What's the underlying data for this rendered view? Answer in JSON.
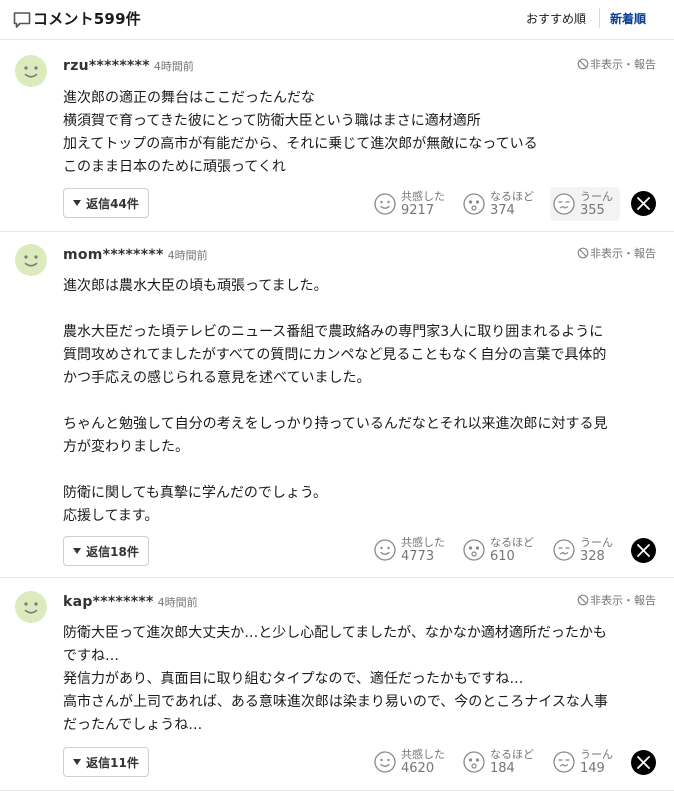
{
  "header": {
    "title": "コメント599件",
    "sort_recommended": "おすすめ順",
    "sort_newest": "新着順"
  },
  "labels": {
    "hide": "非表示",
    "dot": "・",
    "report": "報告",
    "empathy": "共感した",
    "naruhodo": "なるほど",
    "uun": "うーん"
  },
  "comments": [
    {
      "user": "rzu********",
      "time": "4時間前",
      "lines": [
        "進次郎の適正の舞台はここだったんだな",
        "横須賀で育ってきた彼にとって防衛大臣という職はまさに適材適所",
        "加えてトップの高市が有能だから、それに乗じて進次郎が無敵になっている",
        "このまま日本のために頑張ってくれ"
      ],
      "reply_label": "返信44件",
      "empathy": "9217",
      "naruhodo": "374",
      "uun": "355"
    },
    {
      "user": "mom********",
      "time": "4時間前",
      "lines": [
        "進次郎は農水大臣の頃も頑張ってました。",
        "",
        "農水大臣だった頃テレビのニュース番組で農政絡みの専門家3人に取り囲まれるように",
        "質問攻めされてましたがすべての質問にカンペなど見ることもなく自分の言葉で具体的",
        "かつ手応えの感じられる意見を述べていました。",
        "",
        "ちゃんと勉強して自分の考えをしっかり持っているんだなとそれ以来進次郎に対する見",
        "方が変わりました。",
        "",
        "防衛に関しても真摯に学んだのでしょう。",
        "応援してます。"
      ],
      "reply_label": "返信18件",
      "empathy": "4773",
      "naruhodo": "610",
      "uun": "328"
    },
    {
      "user": "kap********",
      "time": "4時間前",
      "lines": [
        "防衛大臣って進次郎大丈夫か…と少し心配してましたが、なかなか適材適所だったかも",
        "ですね…",
        "発信力があり、真面目に取り組むタイプなので、適任だったかもですね…",
        "高市さんが上司であれば、ある意味進次郎は染まり易いので、今のところナイスな人事",
        "だったんでしょうね…"
      ],
      "reply_label": "返信11件",
      "empathy": "4620",
      "naruhodo": "184",
      "uun": "149"
    }
  ]
}
